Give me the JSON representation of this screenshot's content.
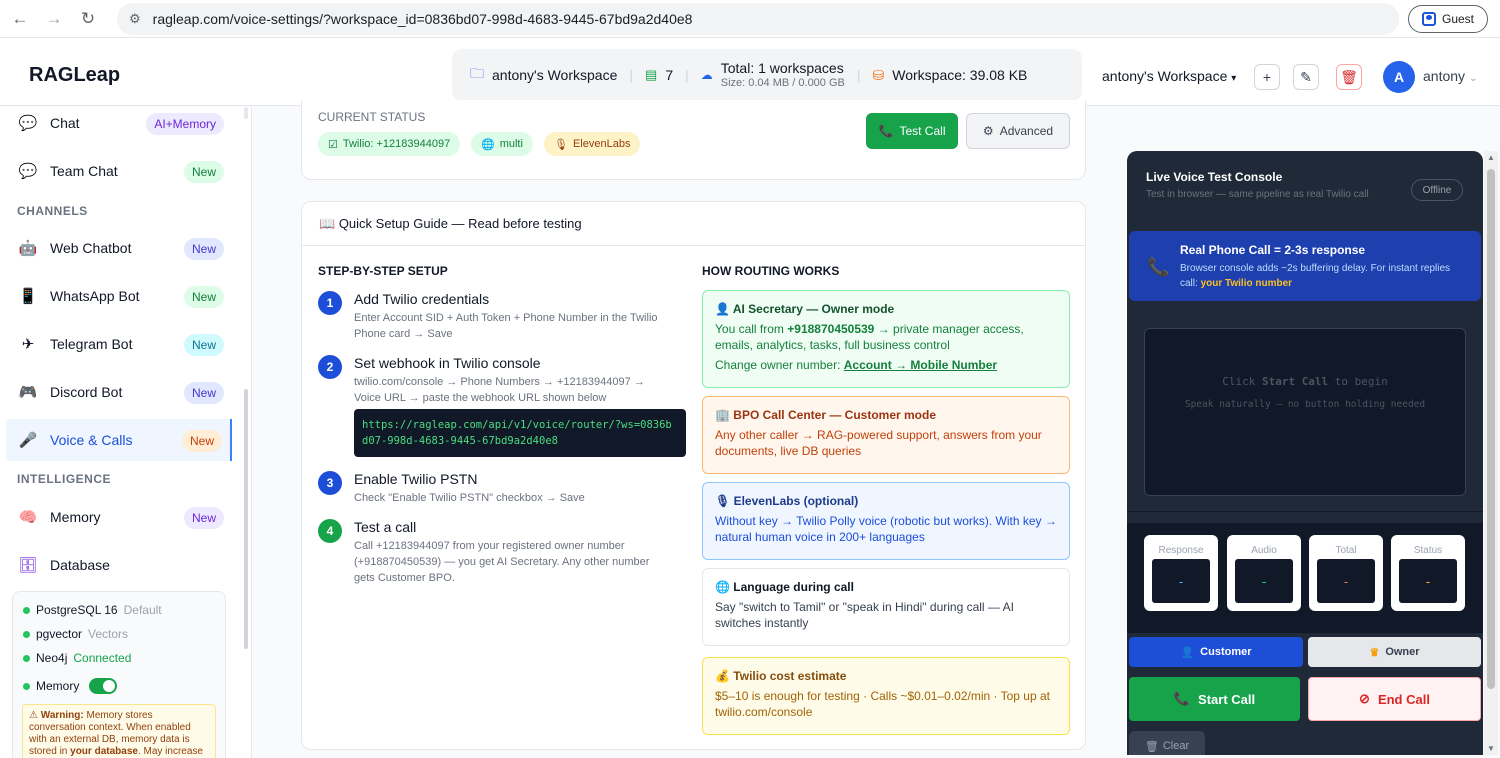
{
  "browser": {
    "url": "ragleap.com/voice-settings/?workspace_id=0836bd07-998d-4683-9445-67bd9a2d40e8",
    "guest_label": "Guest"
  },
  "header": {
    "brand": "RAGLeap",
    "workspace_name": "antony's Workspace",
    "doc_count": "7",
    "total_workspaces": "Total: 1 workspaces",
    "size_line": "Size: 0.04 MB / 0.000 GB",
    "workspace_size": "Workspace: 39.08 KB",
    "workspace_select": "antony's Workspace",
    "avatar_initial": "A",
    "user_name": "antony"
  },
  "sidebar": {
    "items": [
      {
        "label": "Chat",
        "badge": "AI+Memory"
      },
      {
        "label": "Team Chat",
        "badge": "New"
      },
      {
        "label": "Web Chatbot",
        "badge": "New"
      },
      {
        "label": "WhatsApp Bot",
        "badge": "New"
      },
      {
        "label": "Telegram Bot",
        "badge": "New"
      },
      {
        "label": "Discord Bot",
        "badge": "New"
      },
      {
        "label": "Voice & Calls",
        "badge": "New"
      },
      {
        "label": "Memory",
        "badge": "New"
      },
      {
        "label": "Database",
        "badge": ""
      }
    ],
    "section_channels": "CHANNELS",
    "section_intelligence": "INTELLIGENCE",
    "db": {
      "postgres": "PostgreSQL 16",
      "postgres_tag": "Default",
      "pgvector": "pgvector",
      "pgvector_tag": "Vectors",
      "neo4j": "Neo4j",
      "neo4j_tag": "Connected",
      "memory": "Memory",
      "warning_bold": "Warning:",
      "warning_text": " Memory stores conversation context. When enabled with an external DB, memory data is stored in ",
      "warning_bold2": "your database",
      "warning_tail": ". May increase"
    }
  },
  "status": {
    "label": "CURRENT STATUS",
    "chip_twilio": "Twilio: +12183944097",
    "chip_multi": "multi",
    "chip_eleven": "ElevenLabs",
    "test_call": "Test Call",
    "advanced": "Advanced"
  },
  "guide": {
    "title": "Quick Setup Guide — Read before testing",
    "left_heading": "STEP-BY-STEP SETUP",
    "right_heading": "HOW ROUTING WORKS",
    "steps": [
      {
        "num": "1",
        "title": "Add Twilio credentials",
        "desc": "Enter Account SID + Auth Token + Phone Number in the Twilio Phone card → Save"
      },
      {
        "num": "2",
        "title": "Set webhook in Twilio console",
        "desc": "twilio.com/console → Phone Numbers → +12183944097 → Voice URL → paste the webhook URL shown below"
      },
      {
        "num": "3",
        "title": "Enable Twilio PSTN",
        "desc": "Check \"Enable Twilio PSTN\" checkbox → Save"
      },
      {
        "num": "4",
        "title": "Test a call",
        "desc": "Call +12183944097 from your registered owner number (+918870450539) — you get AI Secretary. Any other number gets Customer BPO."
      }
    ],
    "webhook_url": "https://ragleap.com/api/v1/voice/router/?ws=0836bd07-998d-4683-9445-67bd9a2d40e8",
    "routes": {
      "secretary_title": "AI Secretary — Owner mode",
      "secretary_pre": "You call from ",
      "secretary_num": "+918870450539",
      "secretary_post": " → private manager access, emails, analytics, tasks, full business control",
      "secretary_change": "Change owner number: ",
      "secretary_link": "Account → Mobile Number",
      "bpo_title": "BPO Call Center — Customer mode",
      "bpo_text": "Any other caller → RAG-powered support, answers from your documents, live DB queries",
      "eleven_title": "ElevenLabs (optional)",
      "eleven_text": "Without key → Twilio Polly voice (robotic but works). With key → natural human voice in 200+ languages",
      "lang_title": "Language during call",
      "lang_text": "Say \"switch to Tamil\" or \"speak in Hindi\" during call — AI switches instantly",
      "cost_title": "Twilio cost estimate",
      "cost_text": "$5–10 is enough for testing · Calls ~$0.01–0.02/min · Top up at twilio.com/console"
    }
  },
  "console": {
    "title": "Live Voice Test Console",
    "subtitle": "Test in browser — same pipeline as real Twilio call",
    "status": "Offline",
    "banner_title": "Real Phone Call = 2-3s response",
    "banner_text": "Browser console adds ~2s buffering delay. For instant replies call: ",
    "banner_bold": "your Twilio number",
    "stage_pre": "Click ",
    "stage_bold": "Start Call",
    "stage_post": " to begin",
    "stage_hint": "Speak naturally — no button holding needed",
    "metrics": [
      {
        "label": "Response",
        "value": "-",
        "color": "#60a5fa"
      },
      {
        "label": "Audio",
        "value": "-",
        "color": "#34d399"
      },
      {
        "label": "Total",
        "value": "-",
        "color": "#f87171"
      },
      {
        "label": "Status",
        "value": "-",
        "color": "#fbbf24"
      }
    ],
    "customer": "Customer",
    "owner": "Owner",
    "start": "Start Call",
    "end": "End Call",
    "clear": "Clear"
  }
}
